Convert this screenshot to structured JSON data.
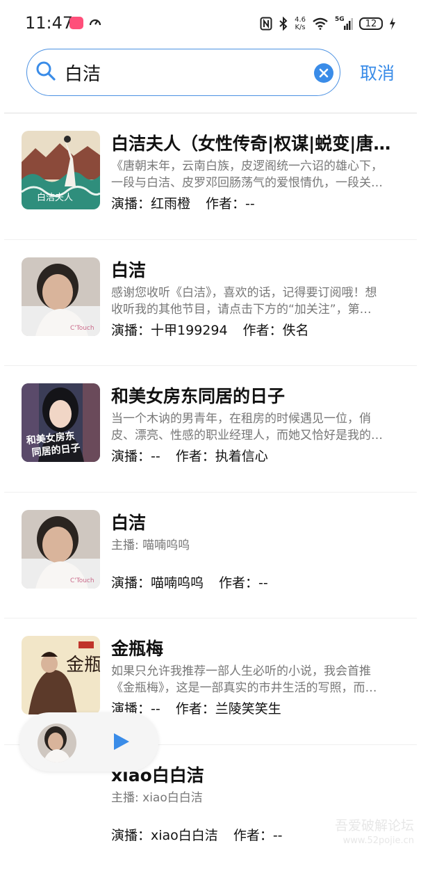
{
  "status_bar": {
    "time": "11:47",
    "net_speed_value": "4.6",
    "net_speed_unit": "K/s",
    "signal_label": "5G",
    "battery_level": "12"
  },
  "search": {
    "query": "白洁",
    "cancel_label": "取消"
  },
  "results": [
    {
      "title": "白洁夫人（女性传奇|权谋|蜕变|唐…",
      "desc_line1": "《唐朝末年，云南白族，皮逻阁统一六诏的雄心下，",
      "desc_line2": "一段与白洁、皮罗邓回肠荡气的爱恨情仇，一段关…",
      "narrator_label": "演播：",
      "narrator": "红雨橙",
      "author_label": "作者：",
      "author": "--"
    },
    {
      "title": "白洁",
      "desc_line1": "感谢您收听《白洁》，喜欢的话，记得要订阅哦！想",
      "desc_line2": "收听我的其他节目，请点击下方的“加关注”，第…",
      "narrator_label": "演播：",
      "narrator": "十甲199294",
      "author_label": "作者：",
      "author": "佚名"
    },
    {
      "title": "和美女房东同居的日子",
      "desc_line1": "当一个木讷的男青年，在租房的时候遇见一位，俏",
      "desc_line2": "皮、漂亮、性感的职业经理人，而她又恰好是我的…",
      "narrator_label": "演播：",
      "narrator": "--",
      "author_label": "作者：",
      "author": "执着信心"
    },
    {
      "title": "白洁",
      "desc_line1": "主播: 喵喃呜呜",
      "desc_line2": "",
      "narrator_label": "演播：",
      "narrator": "喵喃呜呜",
      "author_label": "作者：",
      "author": "--"
    },
    {
      "title": "金瓶梅",
      "desc_line1": "如果只允许我推荐一部人生必听的小说，我会首推",
      "desc_line2": "《金瓶梅》，这是一部真实的市井生活的写照，而…",
      "narrator_label": "演播：",
      "narrator": "--",
      "author_label": "作者：",
      "author": "兰陵笑笑生"
    },
    {
      "title": "xiao白白洁",
      "desc_line1": "主播: xiao白白洁",
      "desc_line2": "",
      "narrator_label": "演播：",
      "narrator": "xiao白白洁",
      "author_label": "作者：",
      "author": "--"
    }
  ],
  "cover_text": {
    "cover_1": "白洁夫人",
    "cover_3": "和美女房东同居的日子",
    "cover_5": "金瓶梅"
  },
  "watermark": {
    "line1": "吾爱破解论坛",
    "line2": "www.52pojie.cn"
  },
  "colors": {
    "accent": "#3a8ce8",
    "title_text": "#111111",
    "desc_text": "#777777",
    "divider": "#e0e0e0"
  },
  "icons": [
    "app-badge-icon",
    "speed-icon",
    "nfc-icon",
    "bluetooth-icon",
    "wifi-icon",
    "signal-icon",
    "battery-icon",
    "charging-icon",
    "search-icon",
    "clear-icon",
    "play-icon"
  ]
}
